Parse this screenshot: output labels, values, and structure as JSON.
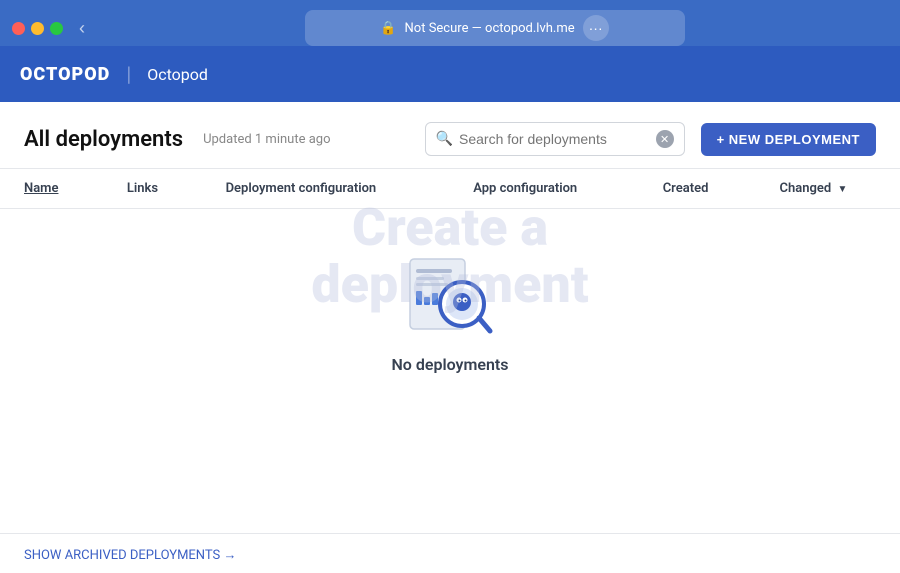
{
  "browser": {
    "traffic_lights": [
      "red",
      "yellow",
      "green"
    ],
    "back_label": "‹",
    "address_text": "Not Secure — octopod.lvh.me",
    "more_label": "···"
  },
  "header": {
    "logo": "OCTOPOD",
    "divider": "|",
    "app_name": "Octopod"
  },
  "page": {
    "title": "All deployments",
    "updated_text": "Updated 1 minute ago",
    "search_placeholder": "Search for deployments",
    "new_deployment_label": "+ NEW DEPLOYMENT",
    "watermark_line1": "Create a",
    "watermark_line2": "deployment"
  },
  "table": {
    "columns": [
      {
        "key": "name",
        "label": "Name",
        "underline": true
      },
      {
        "key": "links",
        "label": "Links"
      },
      {
        "key": "deployment_config",
        "label": "Deployment configuration"
      },
      {
        "key": "app_config",
        "label": "App configuration"
      },
      {
        "key": "created",
        "label": "Created",
        "sortable": false
      },
      {
        "key": "changed",
        "label": "Changed",
        "sortable": true
      }
    ]
  },
  "empty_state": {
    "label": "No deployments"
  },
  "footer": {
    "show_archived_label": "SHOW ARCHIVED DEPLOYMENTS →"
  }
}
